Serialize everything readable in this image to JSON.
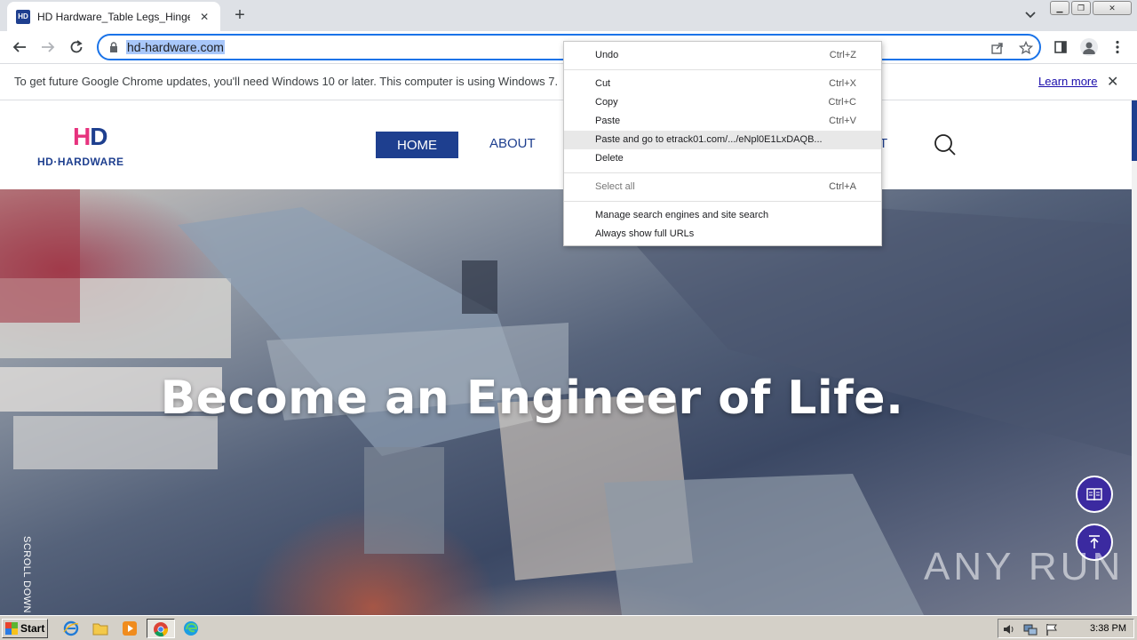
{
  "browser": {
    "tab": {
      "title": "HD Hardware_Table Legs_Hinge_Metal",
      "favicon_text": "HD"
    },
    "address_bar": {
      "url": "hd-hardware.com"
    },
    "infobar": {
      "message": "To get future Google Chrome updates, you'll need Windows 10 or later. This computer is using Windows 7.",
      "link": "Learn more"
    }
  },
  "site": {
    "logo": {
      "mark_pink": "H",
      "mark_blue": "D",
      "wordmark": "HD·HARDWARE"
    },
    "nav": {
      "home": "HOME",
      "about": "ABOUT",
      "contact_tail": "T"
    },
    "hero": {
      "title": "Become an Engineer of Life.",
      "scroll_label": "SCROLL DOWN"
    },
    "watermark": "ANY RUN"
  },
  "context_menu": {
    "undo": {
      "label": "Undo",
      "shortcut": "Ctrl+Z"
    },
    "cut": {
      "label": "Cut",
      "shortcut": "Ctrl+X"
    },
    "copy": {
      "label": "Copy",
      "shortcut": "Ctrl+C"
    },
    "paste": {
      "label": "Paste",
      "shortcut": "Ctrl+V"
    },
    "paste_go": {
      "label": "Paste and go to etrack01.com/.../eNpl0E1LxDAQB..."
    },
    "delete": {
      "label": "Delete"
    },
    "select_all": {
      "label": "Select all",
      "shortcut": "Ctrl+A"
    },
    "manage_search": {
      "label": "Manage search engines and site search"
    },
    "show_urls": {
      "label": "Always show full URLs"
    }
  },
  "taskbar": {
    "start": "Start",
    "clock": "3:38 PM"
  },
  "colors": {
    "brand_blue": "#1e3f8f",
    "brand_pink": "#e6337e",
    "float_button": "#3b2aa0"
  }
}
